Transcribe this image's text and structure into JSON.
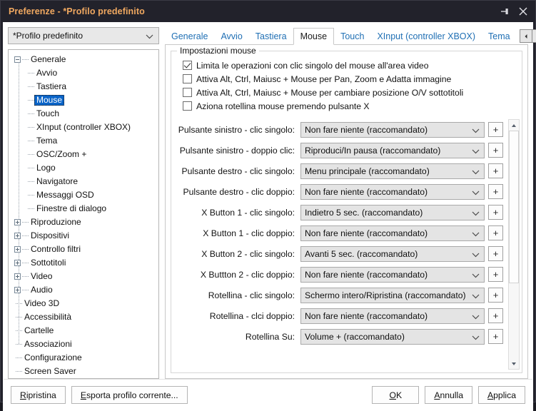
{
  "window": {
    "title": "Preferenze - *Profilo predefinito",
    "titlebar_buttons": [
      {
        "name": "pin-icon",
        "label": "Aggancia"
      },
      {
        "name": "close-icon",
        "label": "Chiudi"
      }
    ],
    "accent_title_color": "#f0a860",
    "titlebar_bg": "#22222b",
    "selection_color": "#0a64c8",
    "tab_link_color": "#1f6fb4"
  },
  "profile_combo": {
    "value": "*Profilo predefinito",
    "placeholder": "*Profilo predefinito"
  },
  "tree": {
    "nodes": [
      {
        "label": "Generale",
        "level": 0,
        "expander": "minus",
        "selected": false
      },
      {
        "label": "Avvio",
        "level": 1,
        "expander": "none",
        "selected": false
      },
      {
        "label": "Tastiera",
        "level": 1,
        "expander": "none",
        "selected": false
      },
      {
        "label": "Mouse",
        "level": 1,
        "expander": "none",
        "selected": true
      },
      {
        "label": "Touch",
        "level": 1,
        "expander": "none",
        "selected": false
      },
      {
        "label": "XInput (controller XBOX)",
        "level": 1,
        "expander": "none",
        "selected": false
      },
      {
        "label": "Tema",
        "level": 1,
        "expander": "none",
        "selected": false
      },
      {
        "label": "OSC/Zoom +",
        "level": 1,
        "expander": "none",
        "selected": false
      },
      {
        "label": "Logo",
        "level": 1,
        "expander": "none",
        "selected": false
      },
      {
        "label": "Navigatore",
        "level": 1,
        "expander": "none",
        "selected": false
      },
      {
        "label": "Messaggi OSD",
        "level": 1,
        "expander": "none",
        "selected": false
      },
      {
        "label": "Finestre di dialogo",
        "level": 1,
        "expander": "none",
        "selected": false
      },
      {
        "label": "Riproduzione",
        "level": 0,
        "expander": "plus",
        "selected": false
      },
      {
        "label": "Dispositivi",
        "level": 0,
        "expander": "plus",
        "selected": false
      },
      {
        "label": "Controllo filtri",
        "level": 0,
        "expander": "plus",
        "selected": false
      },
      {
        "label": "Sottotitoli",
        "level": 0,
        "expander": "plus",
        "selected": false
      },
      {
        "label": "Video",
        "level": 0,
        "expander": "plus",
        "selected": false
      },
      {
        "label": "Audio",
        "level": 0,
        "expander": "plus",
        "selected": false
      },
      {
        "label": "Video 3D",
        "level": 0,
        "expander": "none",
        "selected": false
      },
      {
        "label": "Accessibilità",
        "level": 0,
        "expander": "none",
        "selected": false
      },
      {
        "label": "Cartelle",
        "level": 0,
        "expander": "none",
        "selected": false
      },
      {
        "label": "Associazioni",
        "level": 0,
        "expander": "none",
        "selected": false
      },
      {
        "label": "Configurazione",
        "level": 0,
        "expander": "none",
        "selected": false
      },
      {
        "label": "Screen Saver",
        "level": 0,
        "expander": "none",
        "selected": false
      }
    ]
  },
  "tabs": {
    "items": [
      {
        "label": "Generale",
        "active": false
      },
      {
        "label": "Avvio",
        "active": false
      },
      {
        "label": "Tastiera",
        "active": false
      },
      {
        "label": "Mouse",
        "active": true
      },
      {
        "label": "Touch",
        "active": false
      },
      {
        "label": "XInput (controller XBOX)",
        "active": false
      },
      {
        "label": "Tema",
        "active": false
      }
    ],
    "scroll_left": "◄",
    "scroll_right": "►"
  },
  "group": {
    "title": "Impostazioni mouse",
    "checkboxes": [
      {
        "label": "Limita le operazioni con clic singolo del mouse all'area video",
        "checked": true
      },
      {
        "label": "Attiva Alt, Ctrl, Maiusc + Mouse per Pan, Zoom e Adatta immagine",
        "checked": false
      },
      {
        "label": "Attiva Alt, Ctrl, Maiusc + Mouse per cambiare posizione O/V sottotitoli",
        "checked": false
      },
      {
        "label": "Aziona rotellina mouse premendo pulsante X",
        "checked": false
      }
    ],
    "rows": [
      {
        "label": "Pulsante sinistro - clic singolo:",
        "value": "Non fare niente (raccomandato)",
        "add": "+"
      },
      {
        "label": "Pulsante sinistro - doppio clic:",
        "value": "Riproduci/In pausa (raccomandato)",
        "add": "+"
      },
      {
        "label": "Pulsante destro - clic singolo:",
        "value": "Menu principale (raccomandato)",
        "add": "+"
      },
      {
        "label": "Pulsante destro - clic doppio:",
        "value": "Non fare niente (raccomandato)",
        "add": "+"
      },
      {
        "label": "X Button 1 - clic singolo:",
        "value": "Indietro 5  sec. (raccomandato)",
        "add": "+"
      },
      {
        "label": "X Button 1 - clic doppio:",
        "value": "Non fare niente (raccomandato)",
        "add": "+"
      },
      {
        "label": "X Button 2 - clic singolo:",
        "value": "Avanti 5  sec. (raccomandato)",
        "add": "+"
      },
      {
        "label": "X Buttton 2 - clic doppio:",
        "value": "Non fare niente (raccomandato)",
        "add": "+"
      },
      {
        "label": "Rotellina - clic singolo:",
        "value": "Schermo intero/Ripristina (raccomandato)",
        "add": "+"
      },
      {
        "label": "Rotellina - clci doppio:",
        "value": "Non fare niente (raccomandato)",
        "add": "+"
      },
      {
        "label": "Rotellina Su:",
        "value": "Volume + (raccomandato)",
        "add": "+"
      }
    ]
  },
  "buttons": {
    "restore": {
      "accel": "R",
      "rest": "ipristina"
    },
    "export": {
      "accel": "E",
      "rest": "sporta profilo corrente..."
    },
    "ok": {
      "accel": "O",
      "rest": "K"
    },
    "cancel": {
      "accel": "A",
      "rest": "nnulla"
    },
    "apply": {
      "accel": "A",
      "rest": "pplica"
    }
  }
}
